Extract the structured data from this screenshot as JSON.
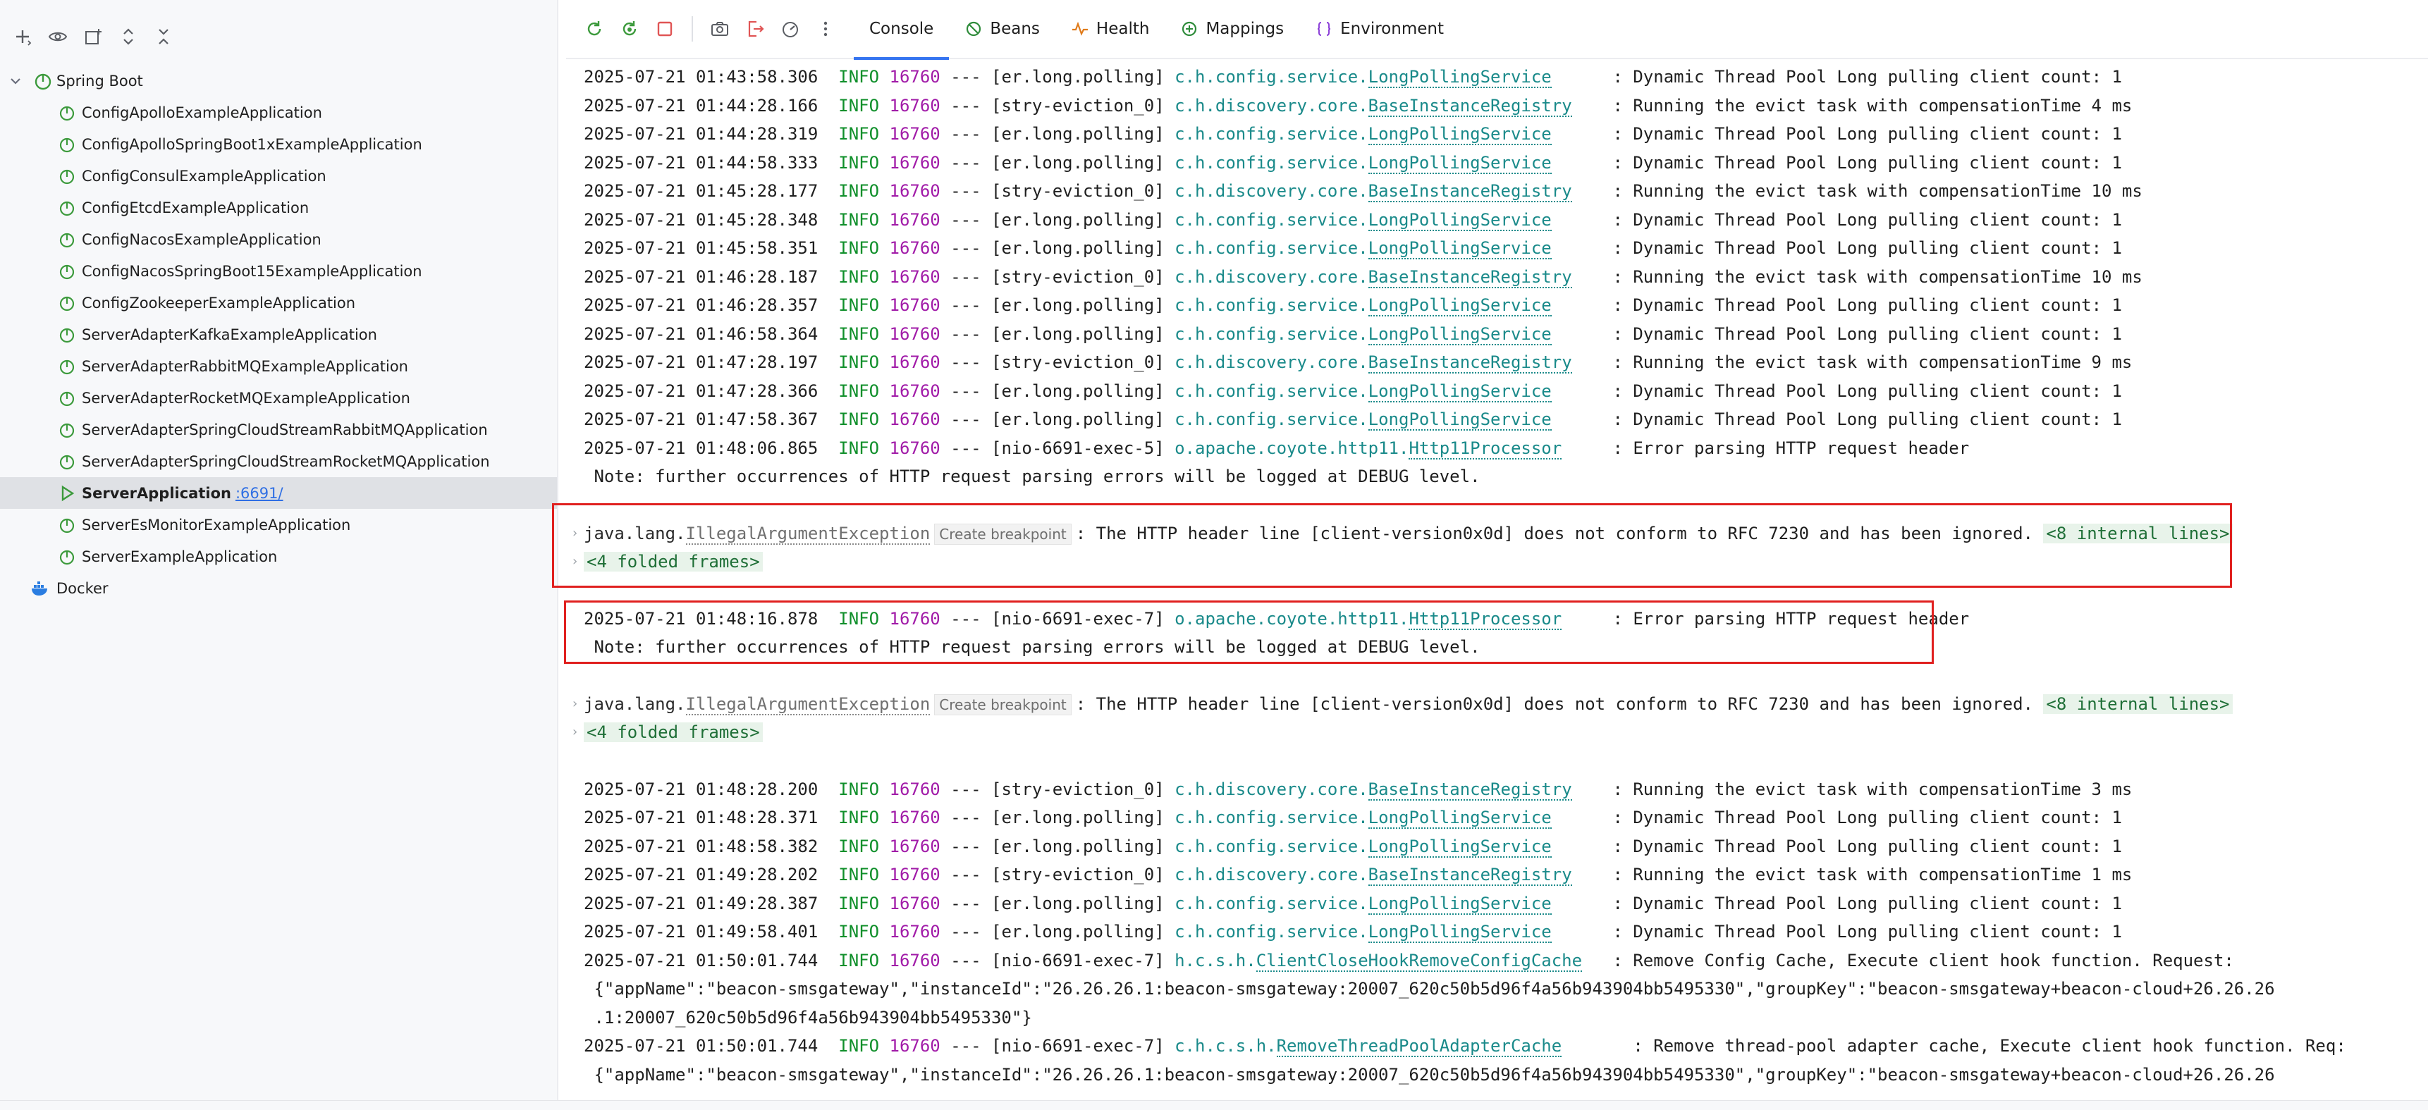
{
  "sidebar": {
    "root_label": "Spring Boot",
    "apps": [
      {
        "label": "ConfigApolloExampleApplication",
        "selected": false
      },
      {
        "label": "ConfigApolloSpringBoot1xExampleApplication",
        "selected": false
      },
      {
        "label": "ConfigConsulExampleApplication",
        "selected": false
      },
      {
        "label": "ConfigEtcdExampleApplication",
        "selected": false
      },
      {
        "label": "ConfigNacosExampleApplication",
        "selected": false
      },
      {
        "label": "ConfigNacosSpringBoot15ExampleApplication",
        "selected": false
      },
      {
        "label": "ConfigZookeeperExampleApplication",
        "selected": false
      },
      {
        "label": "ServerAdapterKafkaExampleApplication",
        "selected": false
      },
      {
        "label": "ServerAdapterRabbitMQExampleApplication",
        "selected": false
      },
      {
        "label": "ServerAdapterRocketMQExampleApplication",
        "selected": false
      },
      {
        "label": "ServerAdapterSpringCloudStreamRabbitMQApplication",
        "selected": false
      },
      {
        "label": "ServerAdapterSpringCloudStreamRocketMQApplication",
        "selected": false
      },
      {
        "label": "ServerApplication",
        "selected": true,
        "port": ":6691/"
      },
      {
        "label": "ServerEsMonitorExampleApplication",
        "selected": false
      },
      {
        "label": "ServerExampleApplication",
        "selected": false
      }
    ],
    "docker_label": "Docker"
  },
  "tabs": [
    {
      "label": "Console",
      "icon": "console",
      "active": true
    },
    {
      "label": "Beans",
      "icon": "beans-icon",
      "active": false
    },
    {
      "label": "Health",
      "icon": "health-icon",
      "active": false
    },
    {
      "label": "Mappings",
      "icon": "mappings-icon",
      "active": false
    },
    {
      "label": "Environment",
      "icon": "environment-icon",
      "active": false
    }
  ],
  "console": {
    "log_lines": [
      {
        "ts": "2025-07-21 01:43:58.306",
        "level": "INFO",
        "pid": "16760",
        "sep": "---",
        "thread": "[er.long.polling]",
        "logger_prefix": "c.h.config.service.",
        "logger_class": "LongPollingService",
        "msg": ": Dynamic Thread Pool Long pulling client count: 1"
      },
      {
        "ts": "2025-07-21 01:44:28.166",
        "level": "INFO",
        "pid": "16760",
        "sep": "---",
        "thread": "[stry-eviction_0]",
        "logger_prefix": "c.h.discovery.core.",
        "logger_class": "BaseInstanceRegistry",
        "msg": ": Running the evict task with compensationTime 4 ms"
      },
      {
        "ts": "2025-07-21 01:44:28.319",
        "level": "INFO",
        "pid": "16760",
        "sep": "---",
        "thread": "[er.long.polling]",
        "logger_prefix": "c.h.config.service.",
        "logger_class": "LongPollingService",
        "msg": ": Dynamic Thread Pool Long pulling client count: 1"
      },
      {
        "ts": "2025-07-21 01:44:58.333",
        "level": "INFO",
        "pid": "16760",
        "sep": "---",
        "thread": "[er.long.polling]",
        "logger_prefix": "c.h.config.service.",
        "logger_class": "LongPollingService",
        "msg": ": Dynamic Thread Pool Long pulling client count: 1"
      },
      {
        "ts": "2025-07-21 01:45:28.177",
        "level": "INFO",
        "pid": "16760",
        "sep": "---",
        "thread": "[stry-eviction_0]",
        "logger_prefix": "c.h.discovery.core.",
        "logger_class": "BaseInstanceRegistry",
        "msg": ": Running the evict task with compensationTime 10 ms"
      },
      {
        "ts": "2025-07-21 01:45:28.348",
        "level": "INFO",
        "pid": "16760",
        "sep": "---",
        "thread": "[er.long.polling]",
        "logger_prefix": "c.h.config.service.",
        "logger_class": "LongPollingService",
        "msg": ": Dynamic Thread Pool Long pulling client count: 1"
      },
      {
        "ts": "2025-07-21 01:45:58.351",
        "level": "INFO",
        "pid": "16760",
        "sep": "---",
        "thread": "[er.long.polling]",
        "logger_prefix": "c.h.config.service.",
        "logger_class": "LongPollingService",
        "msg": ": Dynamic Thread Pool Long pulling client count: 1"
      },
      {
        "ts": "2025-07-21 01:46:28.187",
        "level": "INFO",
        "pid": "16760",
        "sep": "---",
        "thread": "[stry-eviction_0]",
        "logger_prefix": "c.h.discovery.core.",
        "logger_class": "BaseInstanceRegistry",
        "msg": ": Running the evict task with compensationTime 10 ms"
      },
      {
        "ts": "2025-07-21 01:46:28.357",
        "level": "INFO",
        "pid": "16760",
        "sep": "---",
        "thread": "[er.long.polling]",
        "logger_prefix": "c.h.config.service.",
        "logger_class": "LongPollingService",
        "msg": ": Dynamic Thread Pool Long pulling client count: 1"
      },
      {
        "ts": "2025-07-21 01:46:58.364",
        "level": "INFO",
        "pid": "16760",
        "sep": "---",
        "thread": "[er.long.polling]",
        "logger_prefix": "c.h.config.service.",
        "logger_class": "LongPollingService",
        "msg": ": Dynamic Thread Pool Long pulling client count: 1"
      },
      {
        "ts": "2025-07-21 01:47:28.197",
        "level": "INFO",
        "pid": "16760",
        "sep": "---",
        "thread": "[stry-eviction_0]",
        "logger_prefix": "c.h.discovery.core.",
        "logger_class": "BaseInstanceRegistry",
        "msg": ": Running the evict task with compensationTime 9 ms"
      },
      {
        "ts": "2025-07-21 01:47:28.366",
        "level": "INFO",
        "pid": "16760",
        "sep": "---",
        "thread": "[er.long.polling]",
        "logger_prefix": "c.h.config.service.",
        "logger_class": "LongPollingService",
        "msg": ": Dynamic Thread Pool Long pulling client count: 1"
      },
      {
        "ts": "2025-07-21 01:47:58.367",
        "level": "INFO",
        "pid": "16760",
        "sep": "---",
        "thread": "[er.long.polling]",
        "logger_prefix": "c.h.config.service.",
        "logger_class": "LongPollingService",
        "msg": ": Dynamic Thread Pool Long pulling client count: 1"
      },
      {
        "ts": "2025-07-21 01:48:06.865",
        "level": "INFO",
        "pid": "16760",
        "sep": "---",
        "thread": "[nio-6691-exec-5]",
        "logger_prefix": "o.apache.coyote.http11.",
        "logger_class": "Http11Processor",
        "msg": ": Error parsing HTTP request header"
      },
      {
        "text": " Note: further occurrences of HTTP request parsing errors will be logged at DEBUG level."
      },
      {
        "exception": true,
        "exc_prefix": "java.lang.",
        "exc_class": "IllegalArgumentException",
        "badge": "Create breakpoint",
        "msg": ": The HTTP header line [client-version0x0d] does not conform to RFC 7230 and has been ignored.",
        "internal": "<8 internal lines>"
      },
      {
        "folded": "<4 folded frames>"
      },
      {
        "ts": "2025-07-21 01:48:16.878",
        "level": "INFO",
        "pid": "16760",
        "sep": "---",
        "thread": "[nio-6691-exec-7]",
        "logger_prefix": "o.apache.coyote.http11.",
        "logger_class": "Http11Processor",
        "msg": ": Error parsing HTTP request header"
      },
      {
        "text": " Note: further occurrences of HTTP request parsing errors will be logged at DEBUG level."
      },
      {
        "exception": true,
        "exc_prefix": "java.lang.",
        "exc_class": "IllegalArgumentException",
        "badge": "Create breakpoint",
        "msg": ": The HTTP header line [client-version0x0d] does not conform to RFC 7230 and has been ignored.",
        "internal": "<8 internal lines>"
      },
      {
        "folded": "<4 folded frames>"
      },
      {
        "ts": "2025-07-21 01:48:28.200",
        "level": "INFO",
        "pid": "16760",
        "sep": "---",
        "thread": "[stry-eviction_0]",
        "logger_prefix": "c.h.discovery.core.",
        "logger_class": "BaseInstanceRegistry",
        "msg": ": Running the evict task with compensationTime 3 ms"
      },
      {
        "ts": "2025-07-21 01:48:28.371",
        "level": "INFO",
        "pid": "16760",
        "sep": "---",
        "thread": "[er.long.polling]",
        "logger_prefix": "c.h.config.service.",
        "logger_class": "LongPollingService",
        "msg": ": Dynamic Thread Pool Long pulling client count: 1"
      },
      {
        "ts": "2025-07-21 01:48:58.382",
        "level": "INFO",
        "pid": "16760",
        "sep": "---",
        "thread": "[er.long.polling]",
        "logger_prefix": "c.h.config.service.",
        "logger_class": "LongPollingService",
        "msg": ": Dynamic Thread Pool Long pulling client count: 1"
      },
      {
        "ts": "2025-07-21 01:49:28.202",
        "level": "INFO",
        "pid": "16760",
        "sep": "---",
        "thread": "[stry-eviction_0]",
        "logger_prefix": "c.h.discovery.core.",
        "logger_class": "BaseInstanceRegistry",
        "msg": ": Running the evict task with compensationTime 1 ms"
      },
      {
        "ts": "2025-07-21 01:49:28.387",
        "level": "INFO",
        "pid": "16760",
        "sep": "---",
        "thread": "[er.long.polling]",
        "logger_prefix": "c.h.config.service.",
        "logger_class": "LongPollingService",
        "msg": ": Dynamic Thread Pool Long pulling client count: 1"
      },
      {
        "ts": "2025-07-21 01:49:58.401",
        "level": "INFO",
        "pid": "16760",
        "sep": "---",
        "thread": "[er.long.polling]",
        "logger_prefix": "c.h.config.service.",
        "logger_class": "LongPollingService",
        "msg": ": Dynamic Thread Pool Long pulling client count: 1"
      },
      {
        "ts": "2025-07-21 01:50:01.744",
        "level": "INFO",
        "pid": "16760",
        "sep": "---",
        "thread": "[nio-6691-exec-7]",
        "logger_prefix": "h.c.s.h.",
        "logger_class": "ClientCloseHookRemoveConfigCache",
        "msg": ": Remove Config Cache, Execute client hook function. Request:"
      },
      {
        "text": " {\"appName\":\"beacon-smsgateway\",\"instanceId\":\"26.26.26.1:beacon-smsgateway:20007_620c50b5d96f4a56b943904bb5495330\",\"groupKey\":\"beacon-smsgateway+beacon-cloud+26.26.26"
      },
      {
        "text": " .1:20007_620c50b5d96f4a56b943904bb5495330\"}"
      },
      {
        "ts": "2025-07-21 01:50:01.744",
        "level": "INFO",
        "pid": "16760",
        "sep": "---",
        "thread": "[nio-6691-exec-7]",
        "logger_prefix": "c.h.c.s.h.",
        "logger_class": "RemoveThreadPoolAdapterCache",
        "msg": "  : Remove thread-pool adapter cache, Execute client hook function. Req:"
      },
      {
        "text": " {\"appName\":\"beacon-smsgateway\",\"instanceId\":\"26.26.26.1:beacon-smsgateway:20007_620c50b5d96f4a56b943904bb5495330\",\"groupKey\":\"beacon-smsgateway+beacon-cloud+26.26.26"
      }
    ]
  },
  "colors": {
    "level": "#0f8f2a",
    "pid": "#a11ba8",
    "logger": "#1a8a8a",
    "highlight_box": "#e0201f",
    "tab_underline": "#3574f0"
  }
}
